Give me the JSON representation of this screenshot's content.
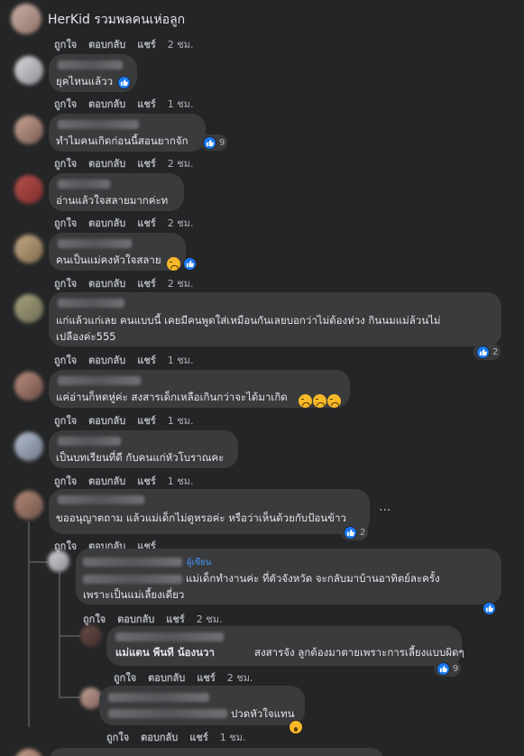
{
  "header": {
    "title": "HerKid รวมพลคนเห่อลูก"
  },
  "actions": {
    "like": "ถูกใจ",
    "reply": "ตอบกลับ",
    "share": "แชร์"
  },
  "comments": [
    {
      "time": "2 ชม."
    },
    {
      "text": "ยุคไหนแล้วว",
      "time": "1 ชม."
    },
    {
      "text": "ทำไมคนเกิดก่อนนี้สอนยากจัก",
      "likes": "9",
      "time": "2 ชม."
    },
    {
      "text": "อ่านแล้วใจสลายมากค่ะท",
      "time": "2 ชม."
    },
    {
      "text": "คนเป็นแม่คงหัวใจสลาย",
      "time": "2 ชม."
    },
    {
      "text_line1": "แก่แล้วแก่เลย คนแบบนี้ เคยมีคนพูดใส่เหมือนกันเลยบอกว่าไม่ต้องห่วง กินนมแม่ล้วนไม่",
      "text_line2": "เปลืองค่ะ555",
      "likes": "2",
      "time": "1 ชม."
    },
    {
      "text": "แค่อ่านก็หดหู่ค่ะ สงสารเด็กเหลือเกินกว่าจะได้มาเกิด",
      "time": "1 ชม."
    },
    {
      "text": "เป็นบทเรียนที่ดี กับคนแก่หัวโบราณคะ",
      "time": "1 ชม."
    },
    {
      "text": "ขออนุญาตถาม แล้วแม่เด็กไม่ดูหรอค่ะ หรือว่าเห็นด้วยกับป้อนข้าว",
      "likes": "2",
      "time": ""
    }
  ],
  "replies": [
    {
      "badge": "ผู้เขียน",
      "text_line1": "แม่เด็กทำงานค่ะ ที่ตัวจังหวัด จะกลับมาบ้านอาทิตย์ละครั้ง",
      "text_line2": "เพราะเป็นแม่เลี้ยงเดี่ยว",
      "time": "2 ชม."
    },
    {
      "tag_name": "แม่แดน พีนที น้องนวา",
      "text": "สงสารจัง ลูกต้องมาตายเพราะการเลี้ยงแบบผิดๆ",
      "likes": "9",
      "time": "2 ชม."
    },
    {
      "text": "ปวดหัวใจแทน",
      "time": "1 ชม."
    }
  ],
  "icons": {
    "like": "like-icon",
    "cry": "crying-face-icon",
    "wow": "wow-face-icon",
    "more": "more-options-icon"
  },
  "colors": {
    "background": "#242526",
    "bubble": "#3a3b3c",
    "text": "#e4e6eb",
    "muted": "#b0b3b8",
    "like_blue": "#1877f2",
    "author_badge": "#4599ff"
  }
}
